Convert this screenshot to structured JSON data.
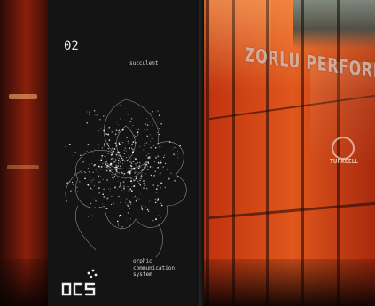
{
  "panel": {
    "number": "02",
    "word": "succulent",
    "caption": [
      "orphic",
      "communication",
      "system"
    ]
  },
  "signage": {
    "main": "ZORLU PERFORMANS SANA",
    "sub": "TURKCELL"
  }
}
